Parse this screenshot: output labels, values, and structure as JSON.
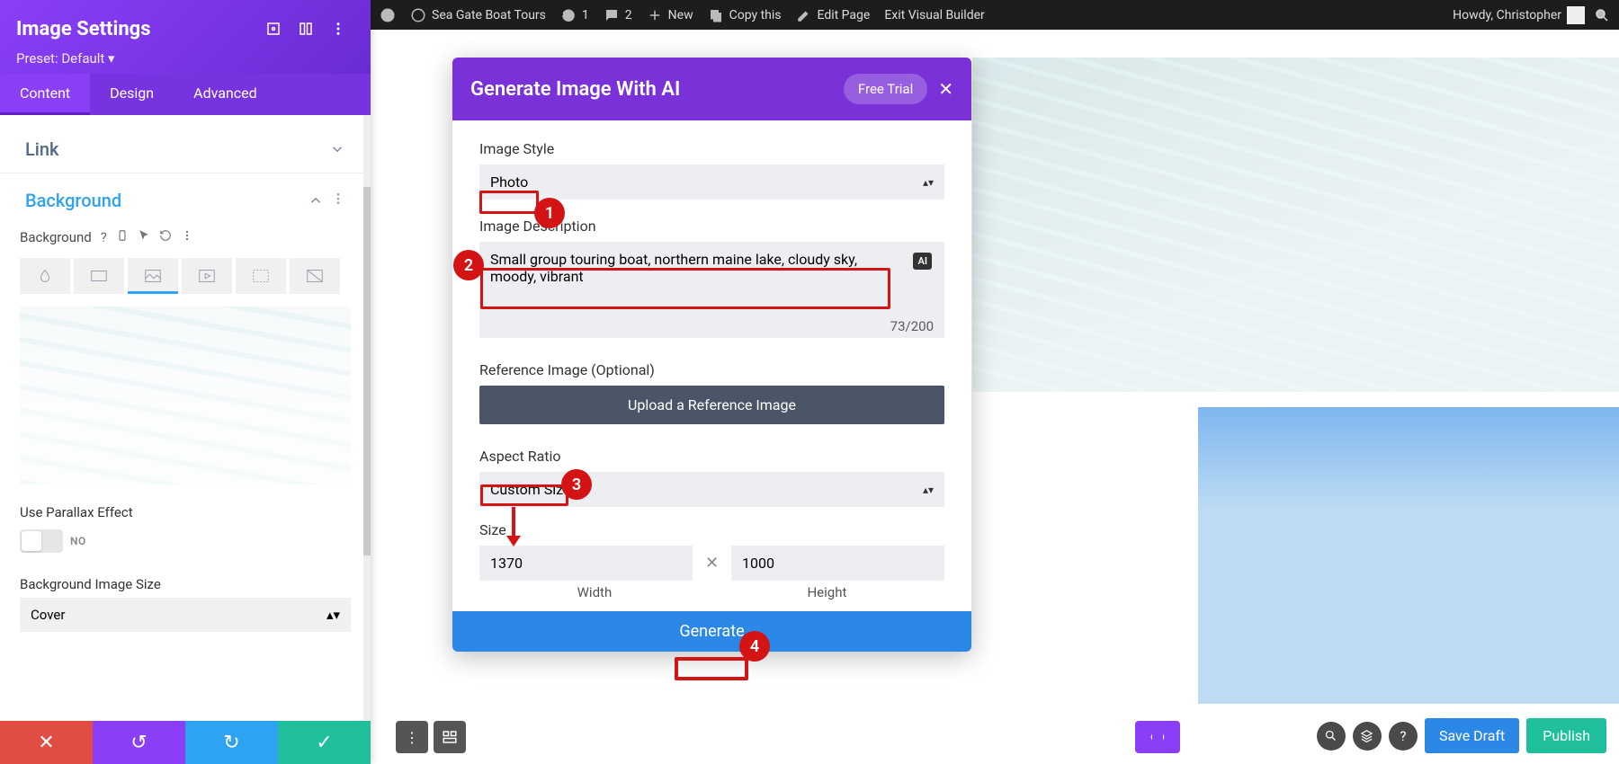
{
  "admin_bar": {
    "site_name": "Sea Gate Boat Tours",
    "updates_count": "1",
    "comments_count": "2",
    "new_label": "New",
    "copy_label": "Copy this",
    "edit_page_label": "Edit Page",
    "exit_vb_label": "Exit Visual Builder",
    "howdy": "Howdy, Christopher"
  },
  "sidebar": {
    "title": "Image Settings",
    "preset": "Preset: Default",
    "tabs": {
      "content": "Content",
      "design": "Design",
      "advanced": "Advanced"
    },
    "section_link": "Link",
    "section_background": "Background",
    "bg_label": "Background",
    "parallax_label": "Use Parallax Effect",
    "parallax_value": "NO",
    "bg_size_label": "Background Image Size",
    "bg_size_value": "Cover"
  },
  "modal": {
    "title": "Generate Image With AI",
    "free_trial": "Free Trial",
    "image_style_label": "Image Style",
    "image_style_value": "Photo",
    "desc_label": "Image Description",
    "desc_value": "Small group touring boat, northern maine lake, cloudy sky, moody, vibrant",
    "ai_chip": "AI",
    "char_count": "73/200",
    "ref_label": "Reference Image (Optional)",
    "upload_btn": "Upload a Reference Image",
    "aspect_label": "Aspect Ratio",
    "aspect_value": "Custom Size",
    "size_label": "Size",
    "width_value": "1370",
    "height_value": "1000",
    "width_label": "Width",
    "height_label": "Height",
    "generate": "Generate"
  },
  "bottom": {
    "save_draft": "Save Draft",
    "publish": "Publish"
  },
  "badges": {
    "b1": "1",
    "b2": "2",
    "b3": "3",
    "b4": "4"
  }
}
